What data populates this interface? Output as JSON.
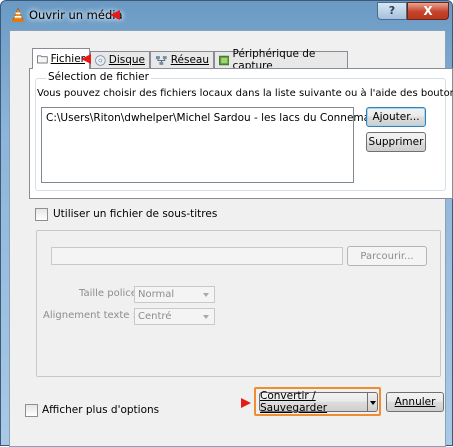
{
  "window": {
    "title": "Ouvrir un média",
    "help_label": "?",
    "close_label": "X"
  },
  "tabs": [
    {
      "label": "Fichier",
      "icon": "folder-icon"
    },
    {
      "label": "Disque",
      "icon": "disc-icon"
    },
    {
      "label": "Réseau",
      "icon": "network-icon"
    },
    {
      "label": "Périphérique de capture",
      "icon": "capture-device-icon"
    }
  ],
  "file_selection": {
    "title": "Sélection de fichier",
    "description": "Vous pouvez choisir des fichiers locaux dans la liste suivante ou à l'aide des boutons.",
    "files": [
      "C:\\Users\\Riton\\dwhelper\\Michel Sardou - les lacs du Connemara.flv"
    ],
    "add_label": "Ajouter...",
    "remove_label": "Supprimer"
  },
  "subtitles": {
    "checkbox_label": "Utiliser un fichier de sous-titres",
    "checked": false,
    "path_value": "",
    "browse_label": "Parcourir...",
    "font_size_label": "Taille police :",
    "font_size_value": "Normal",
    "alignment_label": "Alignement texte :",
    "alignment_value": "Centré"
  },
  "footer": {
    "more_options_label": "Afficher plus d'options",
    "more_options_checked": false,
    "convert_label": "Convertir / Sauvegarder",
    "cancel_label": "Annuler"
  },
  "colors": {
    "annotation_arrow": "#e41b1b",
    "highlight_border": "#f08c32",
    "titlebar": "#8db5d9"
  }
}
